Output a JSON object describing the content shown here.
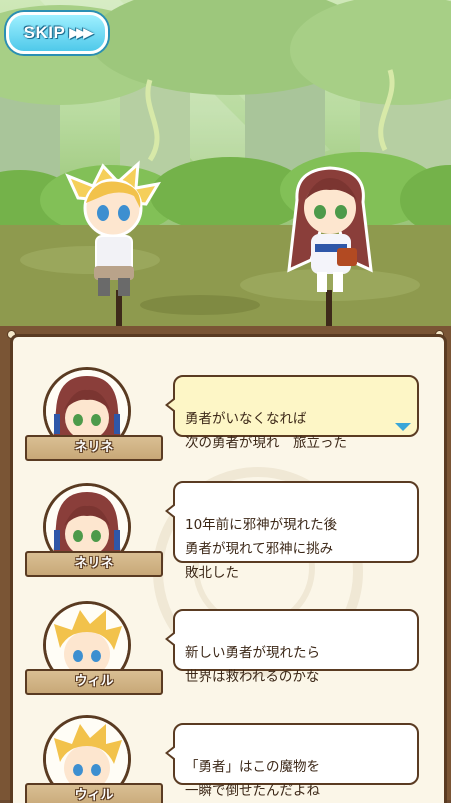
{
  "skip": {
    "label": "SKIP",
    "icon": "fast-forward-icon",
    "glyph": "▶▶▶"
  },
  "log": [
    {
      "speaker": "ネリネ",
      "text": "勇者がいなくなれば\n次の勇者が現れ　旅立った",
      "active": true
    },
    {
      "speaker": "ネリネ",
      "text": "10年前に邪神が現れた後\n勇者が現れて邪神に挑み\n敗北した",
      "active": false
    },
    {
      "speaker": "ウィル",
      "text": "新しい勇者が現れたら\n世界は救われるのかな",
      "active": false
    },
    {
      "speaker": "ウィル",
      "text": "「勇者」はこの魔物を\n一瞬で倒せたんだよね",
      "active": false
    }
  ],
  "colors": {
    "accent": "#4fc9ea",
    "panel_border": "#5a3b22",
    "bubble_active": "#fdf6c6"
  }
}
